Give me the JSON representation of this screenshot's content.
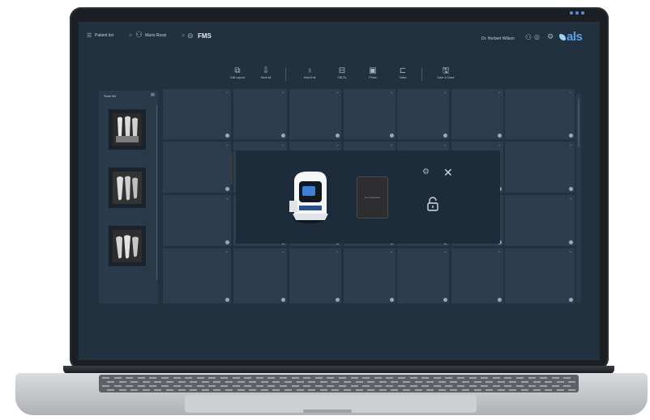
{
  "breadcrumb": {
    "menu_icon": "menu-icon",
    "patient_list": "Patient list",
    "separator": ">",
    "patient_name": "Mario Rossi",
    "current": "FMS"
  },
  "header": {
    "user_name": "Dr. Herbert Wilson",
    "logo_text": "als"
  },
  "toolbar": {
    "items": [
      {
        "label": "Edit Layout",
        "icon": "layout-icon"
      },
      {
        "label": "Save All",
        "icon": "save-all-icon"
      },
      {
        "label": "Intra Oral",
        "icon": "tooth-icon"
      },
      {
        "label": "CBCTs",
        "icon": "cbct-icon"
      },
      {
        "label": "Photo",
        "icon": "camera-icon"
      },
      {
        "label": "Video",
        "icon": "video-icon"
      },
      {
        "label": "Save & Close",
        "icon": "floppy-icon"
      }
    ]
  },
  "scan_list": {
    "title": "Scan list"
  },
  "dialog": {
    "connect_label": "No connection"
  },
  "colors": {
    "screen_bg": "#223140",
    "cell_bg": "#2d3d4d",
    "accent": "#5aa0e6"
  }
}
